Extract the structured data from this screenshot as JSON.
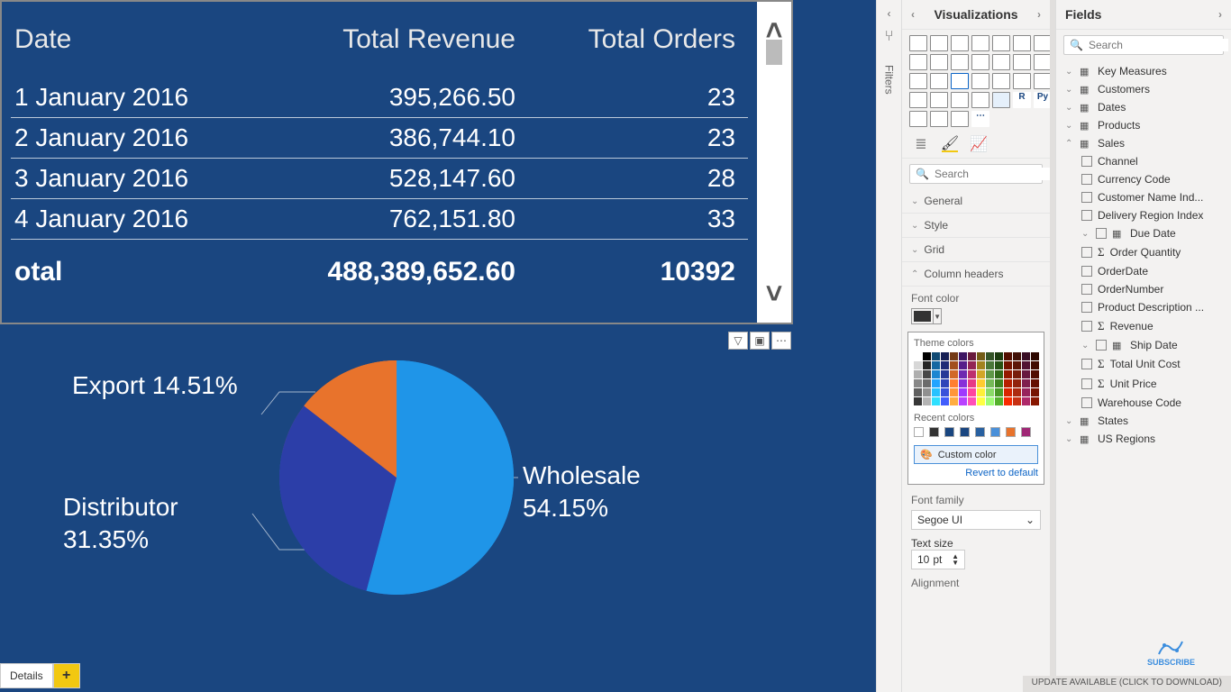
{
  "canvas": {
    "table": {
      "headers": [
        "Date",
        "Total Revenue",
        "Total Orders"
      ],
      "rows": [
        {
          "date": "1 January 2016",
          "revenue": "395,266.50",
          "orders": "23"
        },
        {
          "date": "2 January 2016",
          "revenue": "386,744.10",
          "orders": "23"
        },
        {
          "date": "3 January 2016",
          "revenue": "528,147.60",
          "orders": "28"
        },
        {
          "date": "4 January 2016",
          "revenue": "762,151.80",
          "orders": "33"
        }
      ],
      "total": {
        "label": "otal",
        "revenue": "488,389,652.60",
        "orders": "10392"
      }
    },
    "pie": {
      "labels": {
        "export": "Export 14.51%",
        "distributor_l1": "Distributor",
        "distributor_l2": "31.35%",
        "wholesale_l1": "Wholesale",
        "wholesale_l2": "54.15%"
      }
    },
    "tabs": {
      "details": "Details",
      "plus": "+"
    }
  },
  "filters_pane": {
    "label": "Filters"
  },
  "viz_pane": {
    "title": "Visualizations",
    "search_placeholder": "Search",
    "sections": {
      "general": "General",
      "style": "Style",
      "grid": "Grid",
      "col_headers": "Column headers"
    },
    "font_color": {
      "label": "Font color"
    },
    "picker": {
      "theme": "Theme colors",
      "recent": "Recent colors",
      "custom": "Custom color",
      "revert": "Revert to default"
    },
    "font_family": {
      "label": "Font family",
      "value": "Segoe UI"
    },
    "text_size": {
      "label": "Text size",
      "value": "10",
      "unit": "pt"
    },
    "alignment": {
      "label": "Alignment"
    }
  },
  "fields_pane": {
    "title": "Fields",
    "search_placeholder": "Search",
    "tables": {
      "key_measures": "Key Measures",
      "customers": "Customers",
      "dates": "Dates",
      "products": "Products",
      "sales": "Sales",
      "states": "States",
      "us_regions": "US Regions"
    },
    "sales_cols": {
      "channel": "Channel",
      "currency": "Currency Code",
      "cust_name": "Customer Name Ind...",
      "delivery": "Delivery Region Index",
      "due_date": "Due Date",
      "order_qty": "Order Quantity",
      "order_date": "OrderDate",
      "order_num": "OrderNumber",
      "prod_desc": "Product Description ...",
      "revenue": "Revenue",
      "ship_date": "Ship Date",
      "total_unit": "Total Unit Cost",
      "unit_price": "Unit Price",
      "warehouse": "Warehouse Code"
    }
  },
  "status": {
    "update": "UPDATE AVAILABLE (CLICK TO DOWNLOAD)"
  },
  "subscribe": {
    "label": "SUBSCRIBE"
  },
  "chart_data": [
    {
      "type": "table",
      "title": "",
      "columns": [
        "Date",
        "Total Revenue",
        "Total Orders"
      ],
      "rows": [
        [
          "1 January 2016",
          395266.5,
          23
        ],
        [
          "2 January 2016",
          386744.1,
          23
        ],
        [
          "3 January 2016",
          528147.6,
          28
        ],
        [
          "4 January 2016",
          762151.8,
          33
        ]
      ],
      "totals": [
        "Total",
        488389652.6,
        10392
      ]
    },
    {
      "type": "pie",
      "title": "",
      "series": [
        {
          "name": "Wholesale",
          "value": 54.15,
          "color": "#1f95e8"
        },
        {
          "name": "Distributor",
          "value": 31.35,
          "color": "#2c3ea8"
        },
        {
          "name": "Export",
          "value": 14.51,
          "color": "#e8732c"
        }
      ]
    }
  ]
}
